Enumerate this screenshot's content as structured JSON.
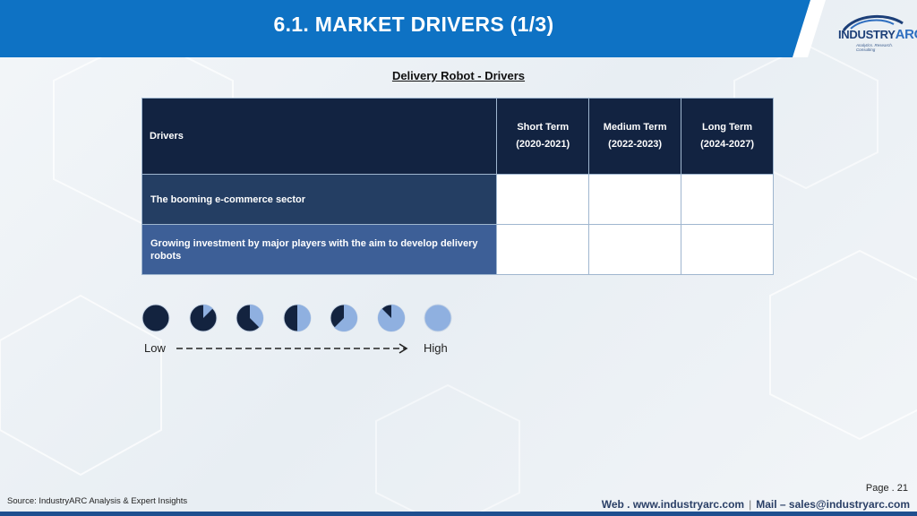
{
  "colors": {
    "banner": "#0e72c4",
    "banner_dark": "#0b5ea6",
    "header_bg": "#122341",
    "row1_bg": "#243e63",
    "row2_bg": "#3d5f97",
    "pie_dark": "#13233f",
    "pie_light": "#8fb0e0"
  },
  "header": {
    "title": "6.1. MARKET DRIVERS (1/3)"
  },
  "logo": {
    "word1": "INDUSTRY",
    "word2": "ARC",
    "tagline": "Analytics. Research. Consulting"
  },
  "subtitle": "Delivery Robot - Drivers",
  "table": {
    "col_drivers": "Drivers",
    "terms": [
      {
        "label": "Short Term",
        "range": "(2020-2021)"
      },
      {
        "label": "Medium Term",
        "range": "(2022-2023)"
      },
      {
        "label": "Long Term",
        "range": "(2024-2027)"
      }
    ],
    "rows": [
      {
        "label": "The booming e-commerce sector"
      },
      {
        "label": "Growing investment by major players with the aim to develop delivery robots"
      }
    ]
  },
  "legend": {
    "low": "Low",
    "high": "High",
    "icons": [
      "pie-0-icon",
      "pie-1-icon",
      "pie-2-icon",
      "pie-3-icon",
      "pie-4-icon",
      "pie-5-icon",
      "pie-6-icon"
    ],
    "light_fractions": [
      0,
      0.125,
      0.375,
      0.5,
      0.625,
      0.875,
      1
    ]
  },
  "footer": {
    "page": "Page . 21",
    "source": "Source: IndustryARC Analysis & Expert Insights",
    "web": "Web . www.industryarc.com",
    "mail": "Mail – sales@industryarc.com"
  }
}
